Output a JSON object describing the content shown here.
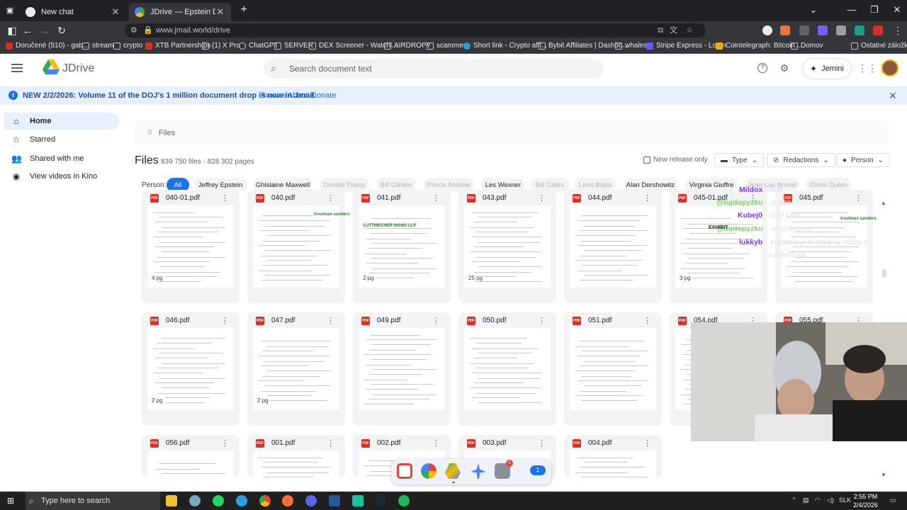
{
  "browser": {
    "tabs": [
      {
        "label": "New chat",
        "icon": "chatgpt-icon"
      },
      {
        "label": "JDrive — Epstein Document Ar",
        "icon": "jdrive-icon"
      }
    ],
    "new_tab": "+",
    "url": "www.jmail.world/drive",
    "bookmarks": [
      "Doručené (510) - gab...",
      "stream",
      "crypto",
      "XTB Partnerships",
      "(1) X Pro",
      "ChatGPT",
      "SERVER",
      "DEX Screener - Watchl...",
      "AIRDROPY",
      "scammer",
      "Short link - Crypto affi...",
      "Bybit Affiliates | Dashbo...",
      "whales",
      "Stripe Express - Login",
      "Cointelegraph: Bitcoin...",
      "Domov",
      "Ostatné záložky"
    ]
  },
  "app": {
    "name": "JDrive",
    "search_placeholder": "Search document text",
    "assistant_label": "Jemini"
  },
  "banner": {
    "text": "NEW 2/2/2026: Volume 11 of the DOJ's 1 million document drop is now in Jmail.",
    "links": [
      "Browse",
      "About",
      "Donate"
    ]
  },
  "sidebar": {
    "items": [
      {
        "label": "Home",
        "icon": "home-icon",
        "active": true
      },
      {
        "label": "Starred",
        "icon": "star-icon"
      },
      {
        "label": "Shared with me",
        "icon": "people-icon"
      },
      {
        "label": "View videos in Kino",
        "icon": "video-icon"
      }
    ]
  },
  "main": {
    "breadcrumb": "Files",
    "title": "Files",
    "count": "839 750 files · 828 302 pages",
    "new_release_only": "New release only",
    "filters": [
      "Type",
      "Redactions",
      "Person"
    ],
    "person_label": "Person:",
    "people": [
      {
        "label": "All",
        "state": "active"
      },
      {
        "label": "Jeffrey Epstein",
        "state": "normal"
      },
      {
        "label": "Ghislaine Maxwell",
        "state": "normal"
      },
      {
        "label": "Donald Trump",
        "state": "dim"
      },
      {
        "label": "Bill Clinton",
        "state": "dim"
      },
      {
        "label": "Prince Andrew",
        "state": "dim"
      },
      {
        "label": "Les Wexner",
        "state": "normal"
      },
      {
        "label": "Bill Gates",
        "state": "dim"
      },
      {
        "label": "Leon Black",
        "state": "dim"
      },
      {
        "label": "Alan Dershowitz",
        "state": "normal"
      },
      {
        "label": "Virginia Giuffre",
        "state": "normal"
      },
      {
        "label": "Jean-Luc Brunel",
        "state": "dim"
      },
      {
        "label": "Glenn Dubin",
        "state": "dim"
      }
    ],
    "files": [
      {
        "name": "040-01.pdf",
        "pages": "4 pg"
      },
      {
        "name": "040.pdf",
        "pages": ""
      },
      {
        "name": "041.pdf",
        "pages": "2 pg"
      },
      {
        "name": "043.pdf",
        "pages": "25 pg"
      },
      {
        "name": "044.pdf",
        "pages": ""
      },
      {
        "name": "045-01.pdf",
        "pages": "3 pg"
      },
      {
        "name": "045.pdf",
        "pages": ""
      },
      {
        "name": "046.pdf",
        "pages": "2 pg"
      },
      {
        "name": "047.pdf",
        "pages": "2 pg"
      },
      {
        "name": "049.pdf",
        "pages": ""
      },
      {
        "name": "050.pdf",
        "pages": ""
      },
      {
        "name": "051.pdf",
        "pages": ""
      },
      {
        "name": "054.pdf",
        "pages": ""
      },
      {
        "name": "055.pdf",
        "pages": ""
      },
      {
        "name": "056.pdf",
        "pages": ""
      },
      {
        "name": "001.pdf",
        "pages": ""
      },
      {
        "name": "002.pdf",
        "pages": ""
      },
      {
        "name": "003.pdf",
        "pages": ""
      },
      {
        "name": "004.pdf",
        "pages": ""
      }
    ],
    "thumb_headers": [
      "troutman sanders",
      "EXHIBIT",
      "troutman sanders",
      "CUTTMECHER WANG LLP"
    ]
  },
  "chat_overlay": [
    {
      "user": "Mildox",
      "msg": "xdd"
    },
    {
      "user": "@tujdopyzku",
      "msg": "ci lebo"
    },
    {
      "user": "Kubej0",
      "msg": "chief keef"
    },
    {
      "user": "@tujdopyzku",
      "msg": "serus keemp"
    },
    {
      "user": "lukkyb",
      "msg": "najlepsia je ta fotka so majou s"
    },
    {
      "user": "",
      "msg": "cundiorz kia"
    }
  ],
  "dock": {
    "badge": "1",
    "badge2": "1"
  },
  "taskbar": {
    "search_placeholder": "Type here to search",
    "language": "SLK",
    "time": "2:55 PM",
    "date": "2/4/2026"
  },
  "colors": {
    "accent": "#1a73e8",
    "banner_bg": "#e8f0fe",
    "pdf_red": "#d93025",
    "chat_green": "#7cd65c",
    "chat_purple": "#7c3aed"
  }
}
